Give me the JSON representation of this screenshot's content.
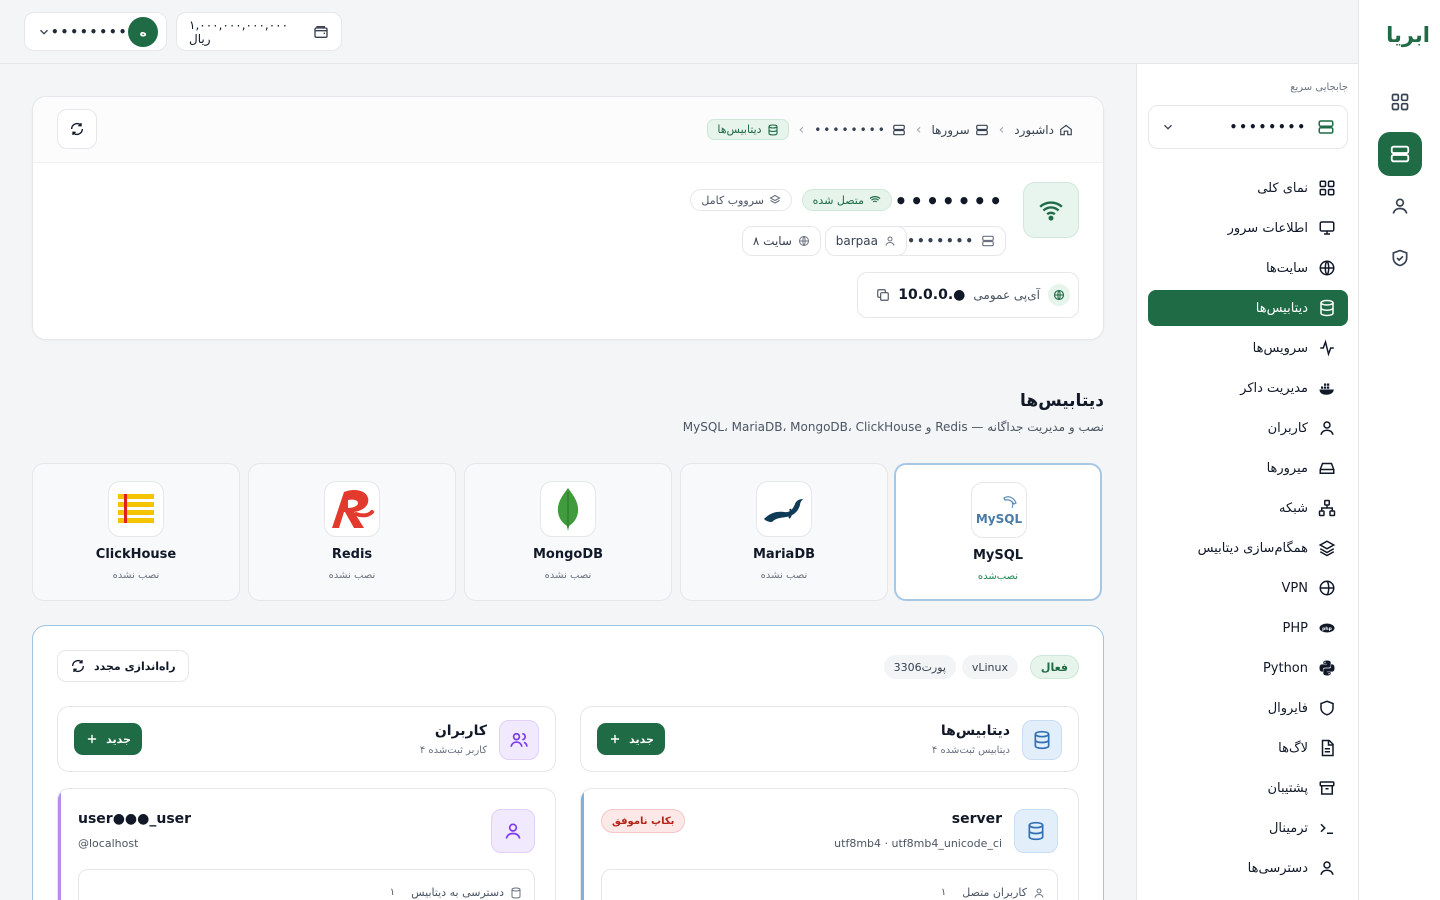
{
  "brand": {
    "logo_text": "ابریا"
  },
  "topbar": {
    "account_name": "••••••••",
    "account_initial": "ه",
    "balance": "۱,۰۰۰,۰۰۰,۰۰۰,۰۰۰ ریال"
  },
  "sidebar": {
    "quick_switch_label": "جابجایی سریع",
    "quick_switch_value": "••••••••",
    "items": [
      {
        "label": "نمای کلی",
        "icon": "grid-icon"
      },
      {
        "label": "اطلاعات سرور",
        "icon": "monitor-icon"
      },
      {
        "label": "سایت‌ها",
        "icon": "globe-icon"
      },
      {
        "label": "دیتابیس‌ها",
        "icon": "database-icon",
        "active": true
      },
      {
        "label": "سرویس‌ها",
        "icon": "activity-icon"
      },
      {
        "label": "مدیریت داکر",
        "icon": "docker-icon"
      },
      {
        "label": "کاربران",
        "icon": "user-icon"
      },
      {
        "label": "میرورها",
        "icon": "hard-drive-icon"
      },
      {
        "label": "شبکه",
        "icon": "network-icon"
      },
      {
        "label": "همگام‌سازی دیتابیس",
        "icon": "layers-icon"
      },
      {
        "label": "VPN",
        "icon": "vpn-globe-icon"
      },
      {
        "label": "PHP",
        "icon": "php-icon"
      },
      {
        "label": "Python",
        "icon": "python-icon"
      },
      {
        "label": "فایروال",
        "icon": "shield-icon"
      },
      {
        "label": "لاگ‌ها",
        "icon": "file-text-icon"
      },
      {
        "label": "پشتیبان",
        "icon": "archive-icon"
      },
      {
        "label": "ترمینال",
        "icon": "terminal-icon"
      },
      {
        "label": "دسترسی‌ها",
        "icon": "user-key-icon"
      }
    ]
  },
  "breadcrumb": {
    "home": "داشبورد",
    "servers": "سرورها",
    "server": "••••••••",
    "current": "دیتابیس‌ها"
  },
  "server": {
    "name": "••••••••",
    "status": "متصل شده",
    "type": "سرووب کامل",
    "host": "••••••••",
    "user": "barpaa",
    "sites": "۸ سایت",
    "ip_label": "آی‌پی عمومی",
    "ip_value": "10.0.0.●"
  },
  "section": {
    "title": "دیتابیس‌ها",
    "subtitle": "MySQL، MariaDB، MongoDB، ClickHouse و Redis — نصب و مدیریت جداگانه"
  },
  "engines": [
    {
      "name": "MySQL",
      "status": "نصب‌شده",
      "selected": true
    },
    {
      "name": "MariaDB",
      "status": "نصب نشده"
    },
    {
      "name": "MongoDB",
      "status": "نصب نشده"
    },
    {
      "name": "Redis",
      "status": "نصب نشده"
    },
    {
      "name": "ClickHouse",
      "status": "نصب نشده"
    }
  ],
  "panel": {
    "reset_label": "راه‌اندازی مجدد",
    "tags": {
      "active": "فعال",
      "version": "vLinux",
      "port": "پورت3306"
    },
    "databases": {
      "title": "دیتابیس‌ها",
      "subtitle": "۴ دیتابیس ثبت‌شده",
      "new_label": "جدید",
      "item": {
        "name": "server",
        "collation": "utf8mb4 · utf8mb4_unicode_ci",
        "badge": "بکاپ ناموفق",
        "connected_label": "کاربران متصل",
        "connected_count": "۱"
      }
    },
    "users": {
      "title": "کاربران",
      "subtitle": "۴ کاربر ثبت‌شده",
      "new_label": "جدید",
      "item": {
        "name": "user●●●_user",
        "host": "@localhost",
        "access_label": "دسترسی به دیتابیس",
        "access_count": "۱"
      }
    }
  },
  "colors": {
    "brand": "#1f6b45",
    "accent_blue": "#7eb0e0",
    "accent_purple": "#b58cf0",
    "danger": "#b42318"
  }
}
